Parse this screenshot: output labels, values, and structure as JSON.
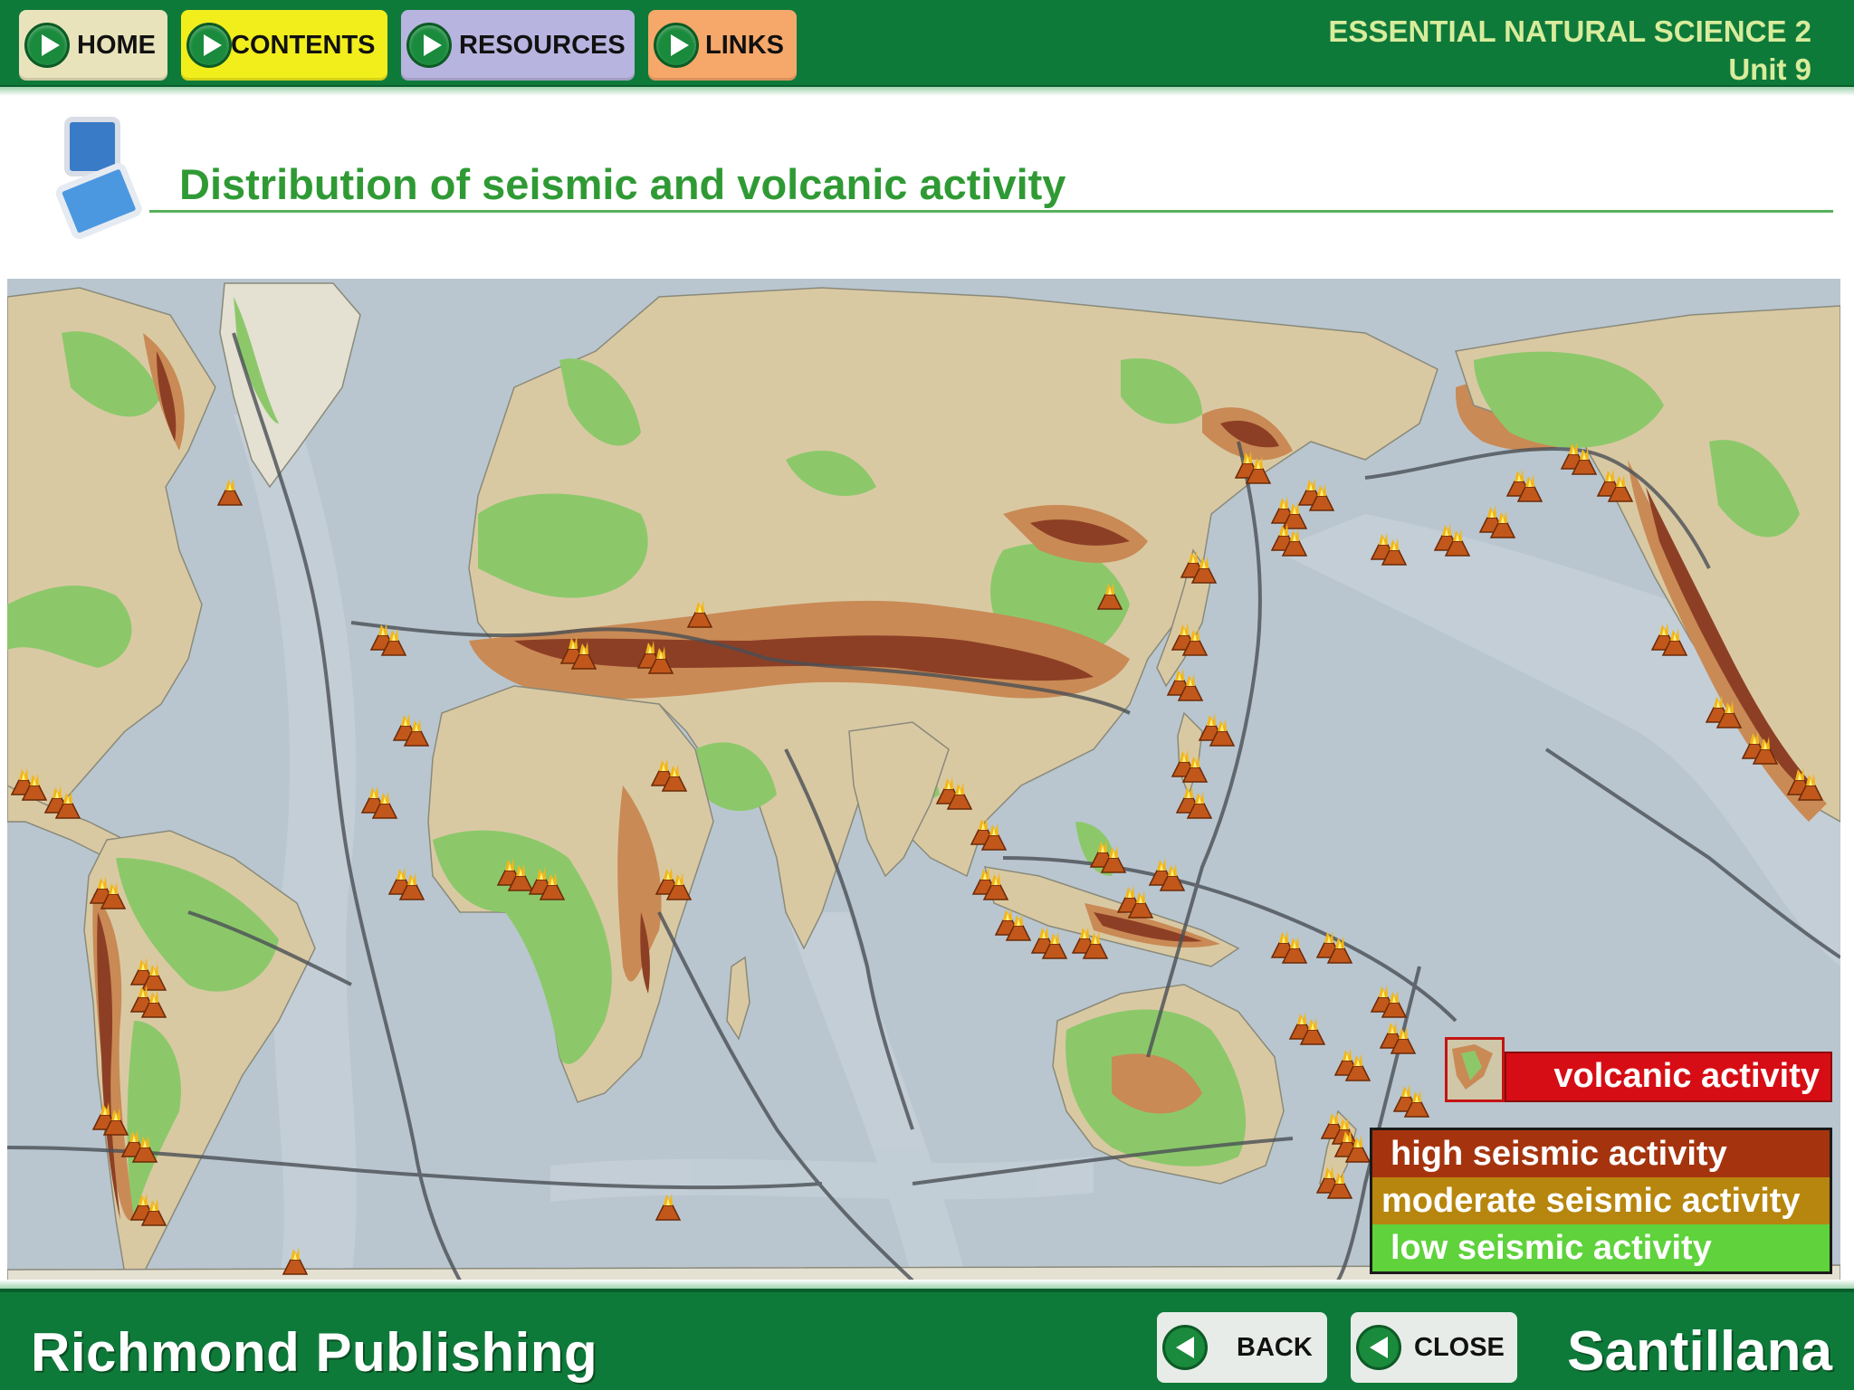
{
  "header": {
    "nav": [
      {
        "label": "HOME",
        "icon": "play-icon"
      },
      {
        "label": "CONTENTS",
        "icon": "play-icon"
      },
      {
        "label": "RESOURCES",
        "icon": "play-icon"
      },
      {
        "label": "LINKS",
        "icon": "play-icon"
      }
    ],
    "book_title": "ESSENTIAL NATURAL SCIENCE 2",
    "unit": "Unit 9"
  },
  "page": {
    "title": "Distribution of seismic and volcanic activity",
    "title_icon": "overlapping-screens-icon"
  },
  "map": {
    "legend": {
      "volcanic": "volcanic activity",
      "high": "high seismic activity",
      "moderate": "moderate seismic activity",
      "low": "low seismic activity"
    },
    "volcano_icon": "volcano-icon",
    "colors": {
      "ocean": "#b9c6cf",
      "land": "#d9c9a3",
      "low": "#8cc86a",
      "moderate": "#c98a55",
      "high": "#8d3f25",
      "volcanic_legend": "#d60d14"
    }
  },
  "footer": {
    "publisher": "Richmond Publishing",
    "brand": "Santillana",
    "back_label": "BACK",
    "close_label": "CLOSE",
    "back_icon": "back-arrow-icon",
    "close_icon": "back-arrow-icon"
  }
}
